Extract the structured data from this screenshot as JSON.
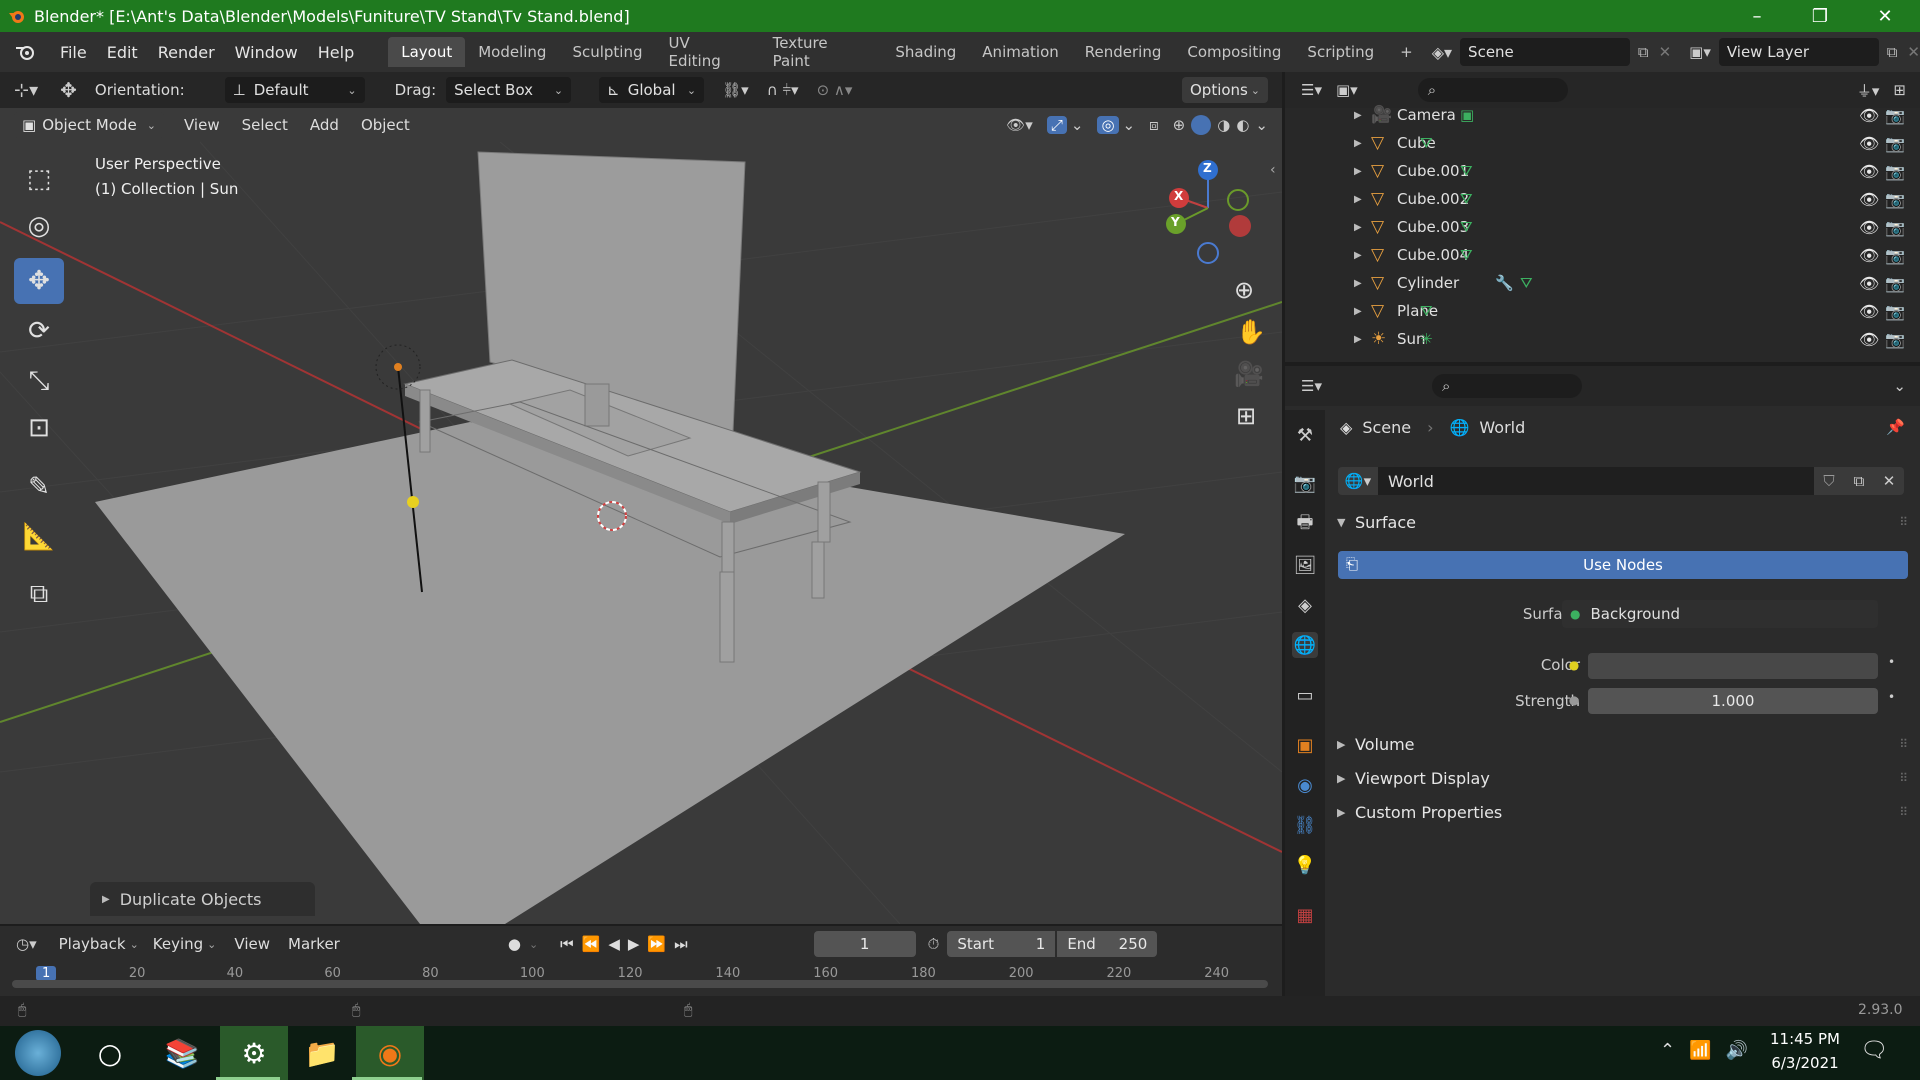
{
  "window": {
    "title": "Blender* [E:\\Ant's Data\\Blender\\Models\\Funiture\\TV Stand\\Tv Stand.blend]",
    "minimize": "–",
    "maximize": "❐",
    "close": "✕"
  },
  "menu": [
    "File",
    "Edit",
    "Render",
    "Window",
    "Help"
  ],
  "workspaces": [
    "Layout",
    "Modeling",
    "Sculpting",
    "UV Editing",
    "Texture Paint",
    "Shading",
    "Animation",
    "Rendering",
    "Compositing",
    "Scripting"
  ],
  "workspace_add": "+",
  "scene_field": "Scene",
  "view_layer_field": "View Layer",
  "viewport_header": {
    "orientation_label": "Orientation:",
    "orientation_value": "Default",
    "drag_label": "Drag:",
    "drag_value": "Select Box",
    "transform_value": "Global",
    "options": "Options",
    "mode": "Object Mode",
    "view": "View",
    "select": "Select",
    "add": "Add",
    "object": "Object"
  },
  "viewport_overlay": {
    "line1": "User Perspective",
    "line2": "(1) Collection | Sun"
  },
  "gizmo": {
    "z": "Z",
    "x": "X",
    "y": "Y"
  },
  "last_operation": "Duplicate Objects",
  "outliner_items": [
    {
      "name": "Camera",
      "icon": "camera-icon",
      "type_icon": "camera-data-icon"
    },
    {
      "name": "Cube",
      "icon": "mesh-object-icon",
      "type_icon": "mesh-data-icon"
    },
    {
      "name": "Cube.001",
      "icon": "mesh-object-icon",
      "type_icon": "mesh-data-icon"
    },
    {
      "name": "Cube.002",
      "icon": "mesh-object-icon",
      "type_icon": "mesh-data-icon"
    },
    {
      "name": "Cube.003",
      "icon": "mesh-object-icon",
      "type_icon": "mesh-data-icon"
    },
    {
      "name": "Cube.004",
      "icon": "mesh-object-icon",
      "type_icon": "mesh-data-icon"
    },
    {
      "name": "Cylinder",
      "icon": "mesh-object-icon",
      "type_icon": "mesh-data-icon"
    },
    {
      "name": "Plane",
      "icon": "mesh-object-icon",
      "type_icon": "mesh-data-icon"
    },
    {
      "name": "Sun",
      "icon": "light-object-icon",
      "type_icon": "sun-data-icon"
    }
  ],
  "properties": {
    "breadcrumb_scene": "Scene",
    "breadcrumb_world": "World",
    "world_name": "World",
    "surface_panel": "Surface",
    "use_nodes": "Use Nodes",
    "surface_label": "Surface",
    "surface_value": "Background",
    "color_label": "Color",
    "strength_label": "Strength",
    "strength_value": "1.000",
    "volume_panel": "Volume",
    "viewport_display_panel": "Viewport Display",
    "custom_properties_panel": "Custom Properties"
  },
  "timeline": {
    "playback": "Playback",
    "keying": "Keying",
    "view": "View",
    "marker": "Marker",
    "current_frame": "1",
    "start_label": "Start",
    "start_value": "1",
    "end_label": "End",
    "end_value": "250",
    "ruler": [
      "1",
      "20",
      "40",
      "60",
      "80",
      "100",
      "120",
      "140",
      "160",
      "180",
      "200",
      "220",
      "240"
    ]
  },
  "status": {
    "version": "2.93.0"
  },
  "taskbar": {
    "time": "11:45 PM",
    "date": "6/3/2021"
  },
  "colors": {
    "title_green": "#1f7a1f",
    "accent_blue": "#4772b3",
    "world_red": "#e0434e"
  }
}
